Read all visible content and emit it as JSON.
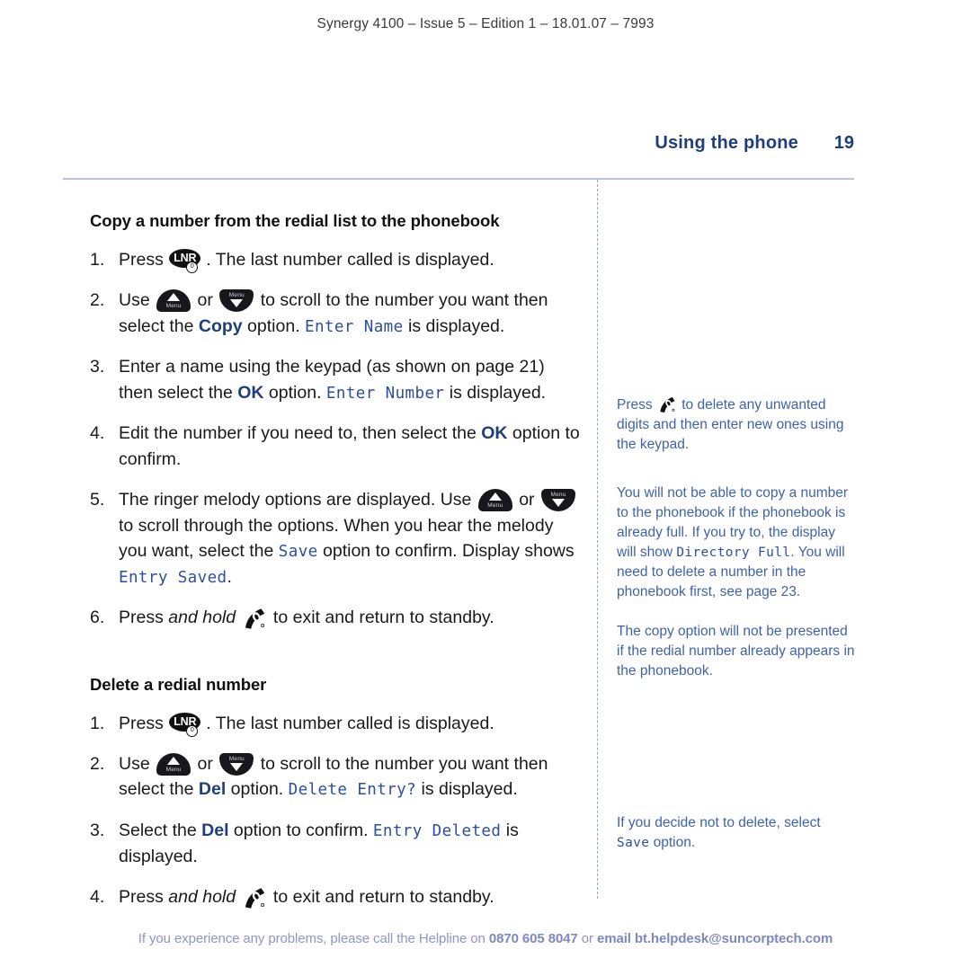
{
  "running_head": "Synergy 4100 – Issue 5 – Edition 1 – 18.01.07 – 7993",
  "header": {
    "chapter": "Using the phone",
    "page_number": "19"
  },
  "colors": {
    "chapter_blue": "#1f3f7a",
    "option_blue": "#1f3f7a",
    "lcd_blue": "#2d4f9e",
    "note_blue": "#3f62ad",
    "footer_blue": "#8d96c8",
    "rule_blue": "#b9c2de",
    "body_black": "#1a1a1a"
  },
  "icons": {
    "lnr": {
      "name": "lnr-key-icon",
      "label": "LNR",
      "sub_label": "0"
    },
    "up": {
      "name": "scroll-up-key-icon",
      "label": "Menu"
    },
    "down": {
      "name": "scroll-down-key-icon",
      "label": "Menu"
    },
    "handset": {
      "name": "end-call-handset-key-icon"
    }
  },
  "sections": [
    {
      "title": "Copy a number from the redial list to the phonebook",
      "steps": {
        "s1": {
          "a": "Press ",
          "b": ". The last number called is displayed."
        },
        "s2": {
          "a": "Use ",
          "b": " or ",
          "c": " to scroll to the number you want then select the ",
          "option": "Copy",
          "d": " option. ",
          "lcd": "Enter Name",
          "e": " is displayed."
        },
        "s3": {
          "a": "Enter a name using the keypad (as shown on page 21) then select the ",
          "option": "OK",
          "b": " option. ",
          "lcd": "Enter Number",
          "c": " is displayed."
        },
        "s4": {
          "a": "Edit the number if you need to, then select the ",
          "option": "OK",
          "b": " option to confirm."
        },
        "s5": {
          "a": "The ringer melody options are displayed. Use ",
          "b": " or ",
          "c": " to scroll through the options. When you hear the melody you want, select the ",
          "lcd1": "Save",
          "d": " option to confirm. Display shows ",
          "lcd2": "Entry Saved",
          "e": "."
        },
        "s6": {
          "a": "Press ",
          "ital": "and hold",
          "b": " ",
          "c": " to exit and return to standby."
        }
      }
    },
    {
      "title": "Delete a redial number",
      "steps": {
        "s1": {
          "a": "Press ",
          "b": ". The last number called is displayed."
        },
        "s2": {
          "a": "Use ",
          "b": " or ",
          "c": " to scroll to the number you want then select the ",
          "option": "Del",
          "d": " option. ",
          "lcd": "Delete Entry?",
          "e": " is displayed."
        },
        "s3": {
          "a": "Select the ",
          "option": "Del",
          "b": " option to confirm. ",
          "lcd": "Entry Deleted",
          "c": " is displayed."
        },
        "s4": {
          "a": "Press ",
          "ital": "and hold",
          "b": " ",
          "c": " to exit and return to standby."
        }
      }
    }
  ],
  "notes": {
    "n1": {
      "a": "Press ",
      "b": " to delete any unwanted digits and then enter new ones using the keypad."
    },
    "n2": {
      "a": "You will not be able to copy a number to the phonebook if the phonebook is already full. If you try to, the display will show ",
      "lcd": "Directory Full",
      "b": ". You will need to delete a number in the phonebook first, see page 23."
    },
    "n3": {
      "text": "The copy option will not be presented if the redial number already appears in the phonebook."
    },
    "n4": {
      "a": "If you decide not to delete, select ",
      "lcd": "Save",
      "b": " option."
    }
  },
  "footer": {
    "a": "If you experience any problems, please call the Helpline on ",
    "phone": "0870 605 8047",
    "b": " or ",
    "email": "email bt.helpdesk@suncorptech.com"
  }
}
